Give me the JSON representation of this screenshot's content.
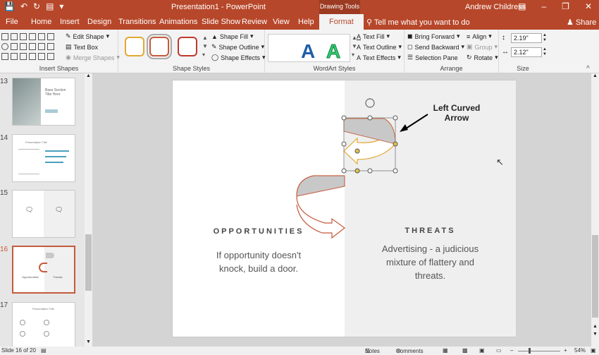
{
  "titlebar": {
    "title": "Presentation1 - PowerPoint",
    "drawing_tools": "Drawing Tools",
    "user": "Andrew Childress",
    "qat_icons": [
      "save-icon",
      "undo-icon",
      "redo-icon",
      "present-icon",
      "customize-icon"
    ],
    "window_controls": [
      "ribbon-display-icon",
      "minimize-icon",
      "restore-icon",
      "close-icon"
    ]
  },
  "tabs": {
    "items": [
      "File",
      "Home",
      "Insert",
      "Design",
      "Transitions",
      "Animations",
      "Slide Show",
      "Review",
      "View",
      "Help",
      "Format"
    ],
    "active": "Format",
    "tell_me": "Tell me what you want to do",
    "share": "Share"
  },
  "ribbon": {
    "insert_shapes": {
      "label": "Insert Shapes",
      "edit_shape": "Edit Shape",
      "text_box": "Text Box",
      "merge_shapes": "Merge Shapes"
    },
    "shape_styles": {
      "label": "Shape Styles",
      "shape_fill": "Shape Fill",
      "shape_outline": "Shape Outline",
      "shape_effects": "Shape Effects",
      "swatch_colors": [
        "#e3a834",
        "#c55a3b",
        "#c0392b"
      ]
    },
    "wordart_styles": {
      "label": "WordArt Styles",
      "sample_letter": "A",
      "text_fill": "Text Fill",
      "text_outline": "Text Outline",
      "text_effects": "Text Effects",
      "sample_colors": [
        "#1f5fa8",
        "#2ecc71"
      ]
    },
    "arrange": {
      "label": "Arrange",
      "bring_forward": "Bring Forward",
      "send_backward": "Send Backward",
      "selection_pane": "Selection Pane",
      "align": "Align",
      "group": "Group",
      "rotate": "Rotate"
    },
    "size": {
      "label": "Size",
      "height": "2.19\"",
      "width": "2.12\""
    }
  },
  "thumbnails": {
    "numbers": [
      "13",
      "14",
      "15",
      "16",
      "17"
    ],
    "active": "16",
    "t13_title": "Base Section Title Here",
    "t14_title": "Presentation Title",
    "t16_left": "Opportunities",
    "t16_right": "Threats",
    "t17_title": "Presentation Title"
  },
  "slide": {
    "left_heading": "OPPORTUNITIES",
    "left_body_line1": "If opportunity doesn't",
    "left_body_line2": "knock, build a door.",
    "right_heading": "THREATS",
    "right_body_line1": "Advertising - a judicious",
    "right_body_line2": "mixture of flattery and",
    "right_body_line3": "threats.",
    "callout_line1": "Left Curved",
    "callout_line2": "Arrow",
    "arrow_fill": "#c8c8c8",
    "arrow_stroke": "#c55a3b"
  },
  "statusbar": {
    "slide_info": "Slide 16 of 20",
    "notes": "Notes",
    "comments": "Comments",
    "zoom": "54%"
  }
}
